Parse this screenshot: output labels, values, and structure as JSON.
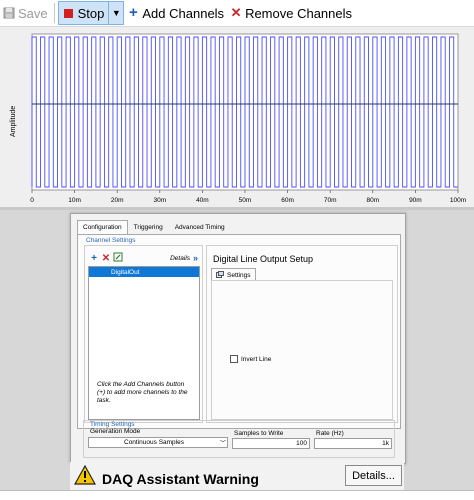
{
  "toolbar": {
    "save_label": "Save",
    "stop_label": "Stop",
    "add_channels_label": "Add Channels",
    "remove_channels_label": "Remove Channels"
  },
  "chart_data": {
    "type": "line",
    "title": "",
    "xlabel": "",
    "ylabel": "Amplitude",
    "x_ticks": [
      "0",
      "10m",
      "20m",
      "30m",
      "40m",
      "50m",
      "60m",
      "70m",
      "80m",
      "90m",
      "100m"
    ],
    "xlim": [
      0,
      0.1
    ],
    "signal": "square",
    "cycles": 50,
    "levels": [
      0,
      1
    ],
    "series": [
      {
        "color": "#4d4dff"
      }
    ],
    "midline_color": "#1f3864"
  },
  "config": {
    "tabs": [
      "Configuration",
      "Triggering",
      "Advanced Timing"
    ],
    "channel_settings": {
      "title": "Channel Settings",
      "details_label": "Details",
      "details_arrows": "»",
      "channels": [
        "DigitalOut"
      ],
      "help_text": "Click the Add Channels button (+) to add more channels to the task."
    },
    "digital_output": {
      "title": "Digital Line Output Setup",
      "settings_tab": "Settings",
      "invert_line_label": "Invert Line"
    },
    "timing": {
      "title": "Timing Settings",
      "generation_mode_label": "Generation Mode",
      "generation_mode_value": "Continuous Samples",
      "samples_label": "Samples to Write",
      "samples_value": "100",
      "rate_label": "Rate (Hz)",
      "rate_value": "1k"
    }
  },
  "warning": {
    "title": "DAQ Assistant Warning",
    "details_label": "Details..."
  }
}
